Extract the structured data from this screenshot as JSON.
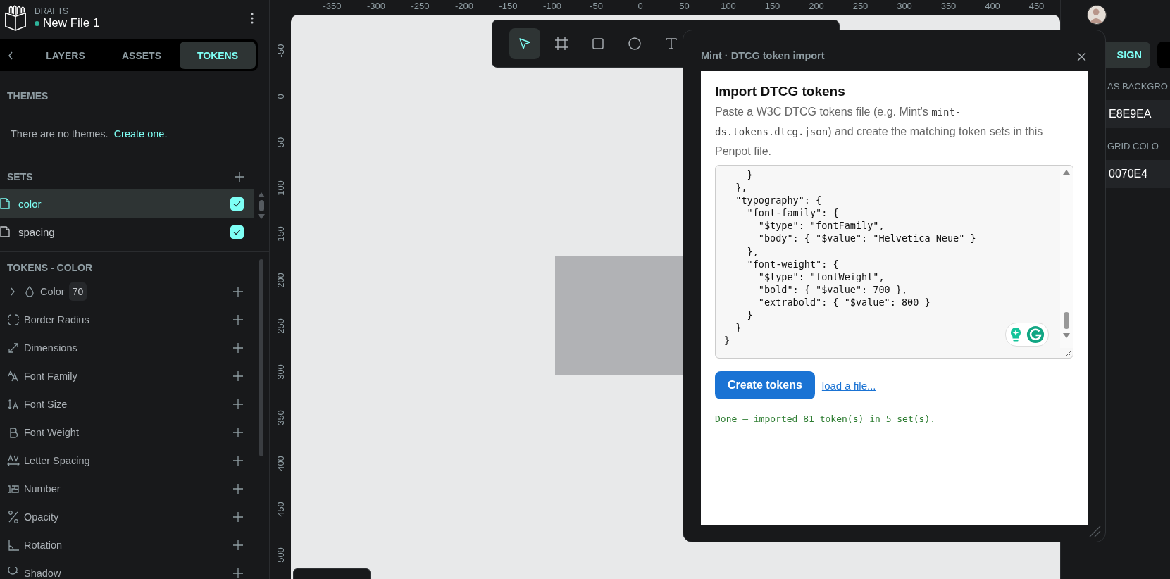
{
  "file": {
    "project": "DRAFTS",
    "name": "New File 1"
  },
  "tabs": [
    {
      "label": "LAYERS",
      "selected": false
    },
    {
      "label": "ASSETS",
      "selected": false
    },
    {
      "label": "TOKENS",
      "selected": true
    }
  ],
  "themes": {
    "title": "THEMES",
    "empty_text": "There are no themes.",
    "create_link": "Create one."
  },
  "sets": {
    "title": "SETS",
    "items": [
      {
        "name": "color",
        "selected": true,
        "checked": true
      },
      {
        "name": "spacing",
        "selected": false,
        "checked": true
      }
    ]
  },
  "tokens": {
    "title": "TOKENS - COLOR",
    "groups": [
      {
        "kind": "color",
        "label": "Color",
        "count": "70"
      },
      {
        "kind": "radius",
        "label": "Border Radius"
      },
      {
        "kind": "dimensions",
        "label": "Dimensions"
      },
      {
        "kind": "font-family",
        "label": "Font Family"
      },
      {
        "kind": "font-size",
        "label": "Font Size"
      },
      {
        "kind": "font-weight",
        "label": "Font Weight"
      },
      {
        "kind": "letter-spacing",
        "label": "Letter Spacing"
      },
      {
        "kind": "number",
        "label": "Number"
      },
      {
        "kind": "opacity",
        "label": "Opacity"
      },
      {
        "kind": "rotation",
        "label": "Rotation"
      },
      {
        "kind": "shadow",
        "label": "Shadow"
      }
    ]
  },
  "rulers": {
    "horizontal": [
      "-350",
      "-300",
      "-250",
      "-200",
      "-150",
      "-100",
      "-50",
      "0",
      "50",
      "100",
      "150",
      "200",
      "250",
      "300",
      "350",
      "400",
      "450"
    ],
    "vertical": [
      "-50",
      "0",
      "50",
      "100",
      "150",
      "200",
      "250",
      "300",
      "350",
      "400",
      "450",
      "500"
    ]
  },
  "toolbar": [
    {
      "kind": "pointer",
      "selected": true
    },
    {
      "kind": "board",
      "selected": false
    },
    {
      "kind": "rect",
      "selected": false
    },
    {
      "kind": "ellipse",
      "selected": false
    },
    {
      "kind": "text",
      "selected": false
    }
  ],
  "dialog": {
    "title": "Mint · DTCG token import",
    "heading": "Import DTCG tokens",
    "description": {
      "before": "Paste a W3C DTCG tokens file (e.g. Mint's ",
      "code": "mint-ds.tokens.dtcg.json",
      "after": ") and create the matching token sets in this Penpot file."
    },
    "json_input": "    }\n  },\n  \"typography\": {\n    \"font-family\": {\n      \"$type\": \"fontFamily\",\n      \"body\": { \"$value\": \"Helvetica Neue\" }\n    },\n    \"font-weight\": {\n      \"$type\": \"fontWeight\",\n      \"bold\": { \"$value\": 700 },\n      \"extrabold\": { \"$value\": 800 }\n    }\n  }\n}",
    "primary_button": "Create tokens",
    "load_link": "load a file...",
    "status": "Done — imported 81 token(s) in 5 set(s)."
  },
  "right_panel": {
    "tab": {
      "label": "SIGN",
      "selected": true
    },
    "fields": [
      {
        "label": "AS BACKGRO",
        "value": "E8E9EA"
      },
      {
        "label": "GRID COLO",
        "value": "0070E4"
      }
    ]
  }
}
